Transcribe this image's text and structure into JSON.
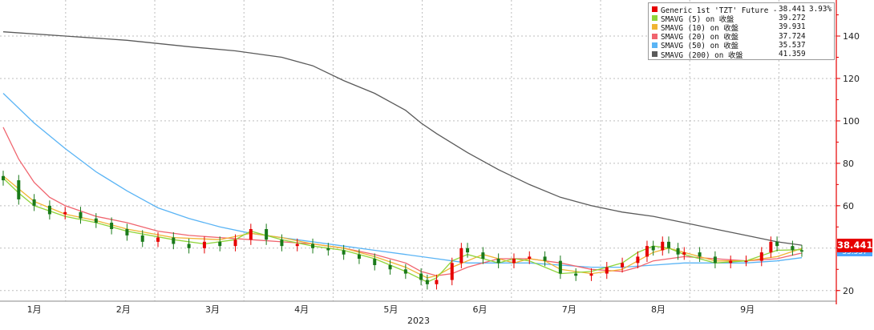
{
  "legend": {
    "items": [
      {
        "name": "Generic 1st 'TZT' Future - 最新價",
        "value": "38.441",
        "change": "3.93%",
        "color": "#e60000",
        "icon": "candlestick-swatch"
      },
      {
        "name": "SMAVG (5)  on 收盤",
        "value": "39.272",
        "change": "",
        "color": "#8fd43a",
        "icon": "line-swatch"
      },
      {
        "name": "SMAVG (10)  on 收盤",
        "value": "39.931",
        "change": "",
        "color": "#f0b433",
        "icon": "line-swatch"
      },
      {
        "name": "SMAVG (20)  on 收盤",
        "value": "37.724",
        "change": "",
        "color": "#f0646e",
        "icon": "line-swatch"
      },
      {
        "name": "SMAVG (50)  on 收盤",
        "value": "35.537",
        "change": "",
        "color": "#5ab4f5",
        "icon": "line-swatch"
      },
      {
        "name": "SMAVG (200)  on 收盤",
        "value": "41.359",
        "change": "",
        "color": "#5a5a5a",
        "icon": "line-swatch"
      }
    ]
  },
  "last_price_badge": {
    "value": "38.441",
    "color": "#e60000"
  },
  "secondary_badge": {
    "value": "35.537",
    "color": "#4da6ff"
  },
  "colors": {
    "axis": "#e60000",
    "up_candle": "#e60000",
    "down_candle": "#1a7a1a",
    "grid": "#bdbdbd"
  },
  "chart_data": {
    "type": "line",
    "title": "",
    "year_label": "2023",
    "x_ticks": [
      "1月",
      "2月",
      "3月",
      "4月",
      "5月",
      "6月",
      "7月",
      "8月",
      "9月"
    ],
    "y_ticks": [
      20,
      40,
      60,
      80,
      100,
      120,
      140
    ],
    "ylim": [
      15,
      157
    ],
    "xlim": [
      0,
      265
    ],
    "y_axis_side": "right",
    "grid": true,
    "legend_position": "top-right",
    "series": [
      {
        "name": "SMAVG (200)  on 收盤",
        "color": "#5a5a5a",
        "x": [
          0,
          20,
          40,
          60,
          75,
          90,
          100,
          110,
          120,
          130,
          135,
          140,
          150,
          160,
          170,
          180,
          190,
          200,
          210,
          220,
          230,
          240,
          250,
          258
        ],
        "y": [
          142,
          140,
          138,
          135,
          133,
          130,
          126,
          119,
          113,
          105,
          99,
          94,
          85,
          77,
          70,
          64,
          60,
          57,
          55,
          52,
          49,
          46,
          43,
          41.4
        ]
      },
      {
        "name": "SMAVG (50)  on 收盤",
        "color": "#5ab4f5",
        "x": [
          0,
          10,
          20,
          30,
          40,
          50,
          60,
          70,
          80,
          90,
          100,
          110,
          120,
          130,
          140,
          145,
          150,
          155,
          160,
          170,
          180,
          190,
          200,
          210,
          220,
          230,
          240,
          250,
          258
        ],
        "y": [
          113,
          99,
          87,
          76,
          67,
          59,
          54,
          50,
          47,
          45,
          43,
          41,
          39,
          37,
          35,
          34,
          33,
          33,
          33,
          33,
          32,
          31,
          31,
          32,
          33,
          33,
          33,
          34,
          35.5
        ]
      },
      {
        "name": "SMAVG (20)  on 收盤",
        "color": "#f0646e",
        "x": [
          0,
          5,
          10,
          15,
          20,
          30,
          40,
          50,
          60,
          70,
          80,
          90,
          100,
          110,
          120,
          130,
          135,
          140,
          145,
          150,
          155,
          160,
          170,
          175,
          180,
          190,
          200,
          205,
          210,
          220,
          230,
          240,
          250,
          258
        ],
        "y": [
          97,
          82,
          71,
          64,
          60,
          55,
          52,
          48,
          46,
          45,
          44,
          43,
          42,
          40,
          37,
          33,
          29,
          27,
          28,
          31,
          33,
          35,
          35,
          34,
          33,
          30,
          29,
          31,
          34,
          36,
          35,
          34,
          35,
          37.7
        ]
      },
      {
        "name": "SMAVG (10)  on 收盤",
        "color": "#f0b433",
        "x": [
          0,
          5,
          10,
          20,
          30,
          40,
          55,
          70,
          80,
          90,
          100,
          110,
          120,
          130,
          137,
          140,
          145,
          150,
          155,
          160,
          165,
          170,
          175,
          180,
          190,
          200,
          205,
          210,
          215,
          220,
          230,
          240,
          250,
          258
        ],
        "y": [
          74,
          68,
          62,
          56,
          53,
          49,
          45,
          44,
          47,
          45,
          42,
          40,
          36,
          31,
          26,
          27,
          31,
          34,
          37,
          35,
          33,
          35,
          34,
          30,
          28,
          30,
          34,
          38,
          40,
          38,
          34,
          34,
          36,
          39.9
        ]
      },
      {
        "name": "SMAVG (5)  on 收盤",
        "color": "#8fd43a",
        "x": [
          0,
          5,
          10,
          20,
          30,
          40,
          55,
          65,
          75,
          80,
          90,
          100,
          110,
          120,
          130,
          137,
          140,
          145,
          150,
          155,
          160,
          165,
          170,
          175,
          180,
          190,
          200,
          205,
          210,
          215,
          220,
          230,
          240,
          250,
          258
        ],
        "y": [
          73,
          66,
          60,
          55,
          52,
          48,
          44,
          42,
          44,
          48,
          44,
          41,
          39,
          35,
          29,
          24,
          26,
          34,
          37,
          35,
          33,
          35,
          34,
          31,
          28,
          29,
          33,
          38,
          41,
          40,
          37,
          33,
          34,
          39,
          39.3
        ]
      }
    ],
    "candles": {
      "name": "Generic 1st 'TZT' Future - 最新價",
      "x": [
        0,
        5,
        10,
        15,
        20,
        25,
        30,
        35,
        40,
        45,
        50,
        55,
        60,
        65,
        70,
        75,
        80,
        85,
        90,
        95,
        100,
        105,
        110,
        115,
        120,
        125,
        130,
        135,
        137,
        140,
        145,
        148,
        150,
        155,
        160,
        165,
        170,
        175,
        180,
        185,
        190,
        195,
        200,
        205,
        208,
        210,
        213,
        215,
        218,
        220,
        225,
        230,
        235,
        240,
        245,
        248,
        250,
        255,
        258
      ],
      "close": [
        72,
        63,
        60,
        56,
        57,
        54,
        52,
        49,
        46,
        43,
        45,
        42,
        40,
        43,
        41,
        44,
        49,
        44,
        41,
        42,
        40,
        39,
        37,
        35,
        32,
        30,
        28,
        25,
        23,
        25,
        33,
        40,
        38,
        35,
        33,
        35,
        36,
        34,
        28,
        27,
        28,
        31,
        33,
        36,
        41,
        39,
        43,
        40,
        37,
        38,
        36,
        33,
        34,
        34,
        38,
        43,
        41,
        39,
        38.4
      ]
    }
  }
}
